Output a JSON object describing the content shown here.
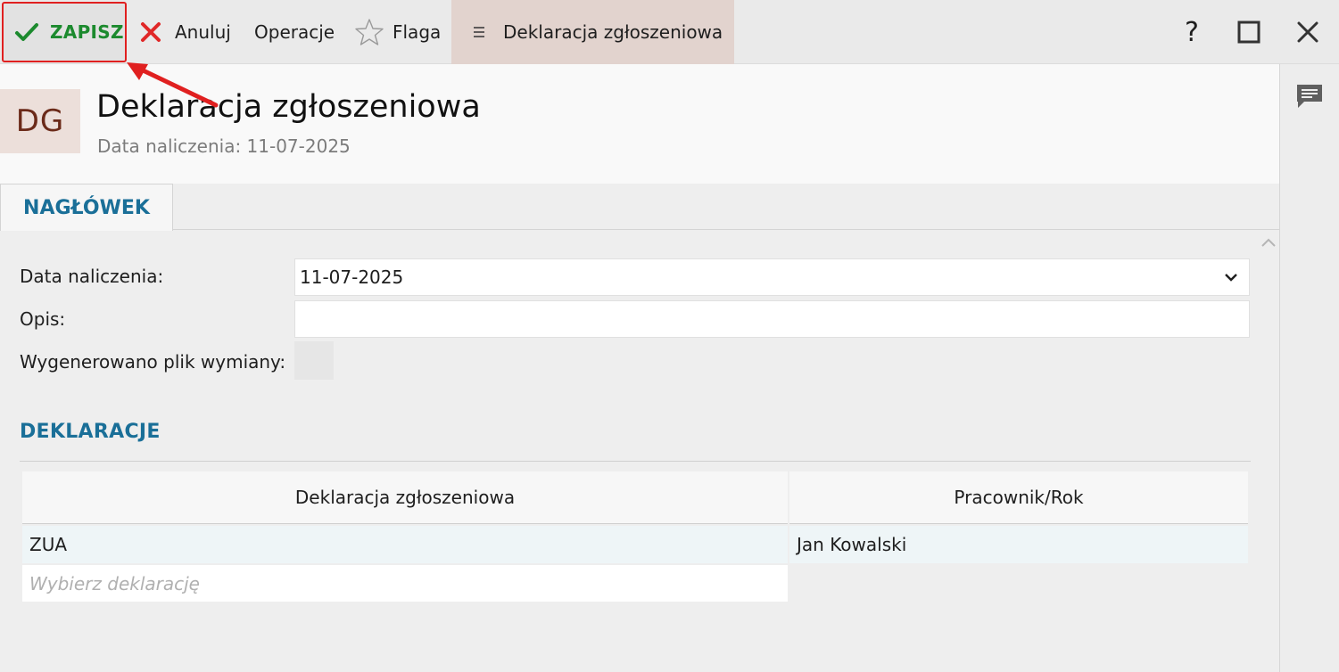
{
  "toolbar": {
    "save_label": "ZAPISZ",
    "cancel_label": "Anuluj",
    "operations_label": "Operacje",
    "flag_label": "Flaga",
    "document_tab_label": "Deklaracja zgłoszeniowa",
    "help_label": "?"
  },
  "header": {
    "avatar_initials": "DG",
    "title": "Deklaracja zgłoszeniowa",
    "subtitle": "Data naliczenia: 11-07-2025"
  },
  "tabs": [
    {
      "label": "NAGŁÓWEK",
      "active": true
    }
  ],
  "form": {
    "date_label": "Data naliczenia:",
    "date_value": "11-07-2025",
    "description_label": "Opis:",
    "description_value": "",
    "exchange_file_label": "Wygenerowano plik wymiany:",
    "exchange_file_checked": false
  },
  "declarations": {
    "section_title": "DEKLARACJE",
    "columns": [
      "Deklaracja zgłoszeniowa",
      "Pracownik/Rok"
    ],
    "rows": [
      {
        "declaration": "ZUA",
        "employee_year": "Jan Kowalski"
      }
    ],
    "new_row_placeholder": "Wybierz deklarację"
  },
  "colors": {
    "save_green": "#1c8a2e",
    "accent_blue": "#1a6f98",
    "highlight_red": "#e02020",
    "doc_tab_bg": "#e2d3ce",
    "avatar_text": "#6b2a19"
  },
  "icons": {
    "save": "check-icon",
    "cancel": "x-icon",
    "flag": "star-icon",
    "menu": "hamburger-icon",
    "help": "question-icon",
    "maximize": "maximize-icon",
    "close": "close-icon",
    "comments": "comment-icon"
  }
}
